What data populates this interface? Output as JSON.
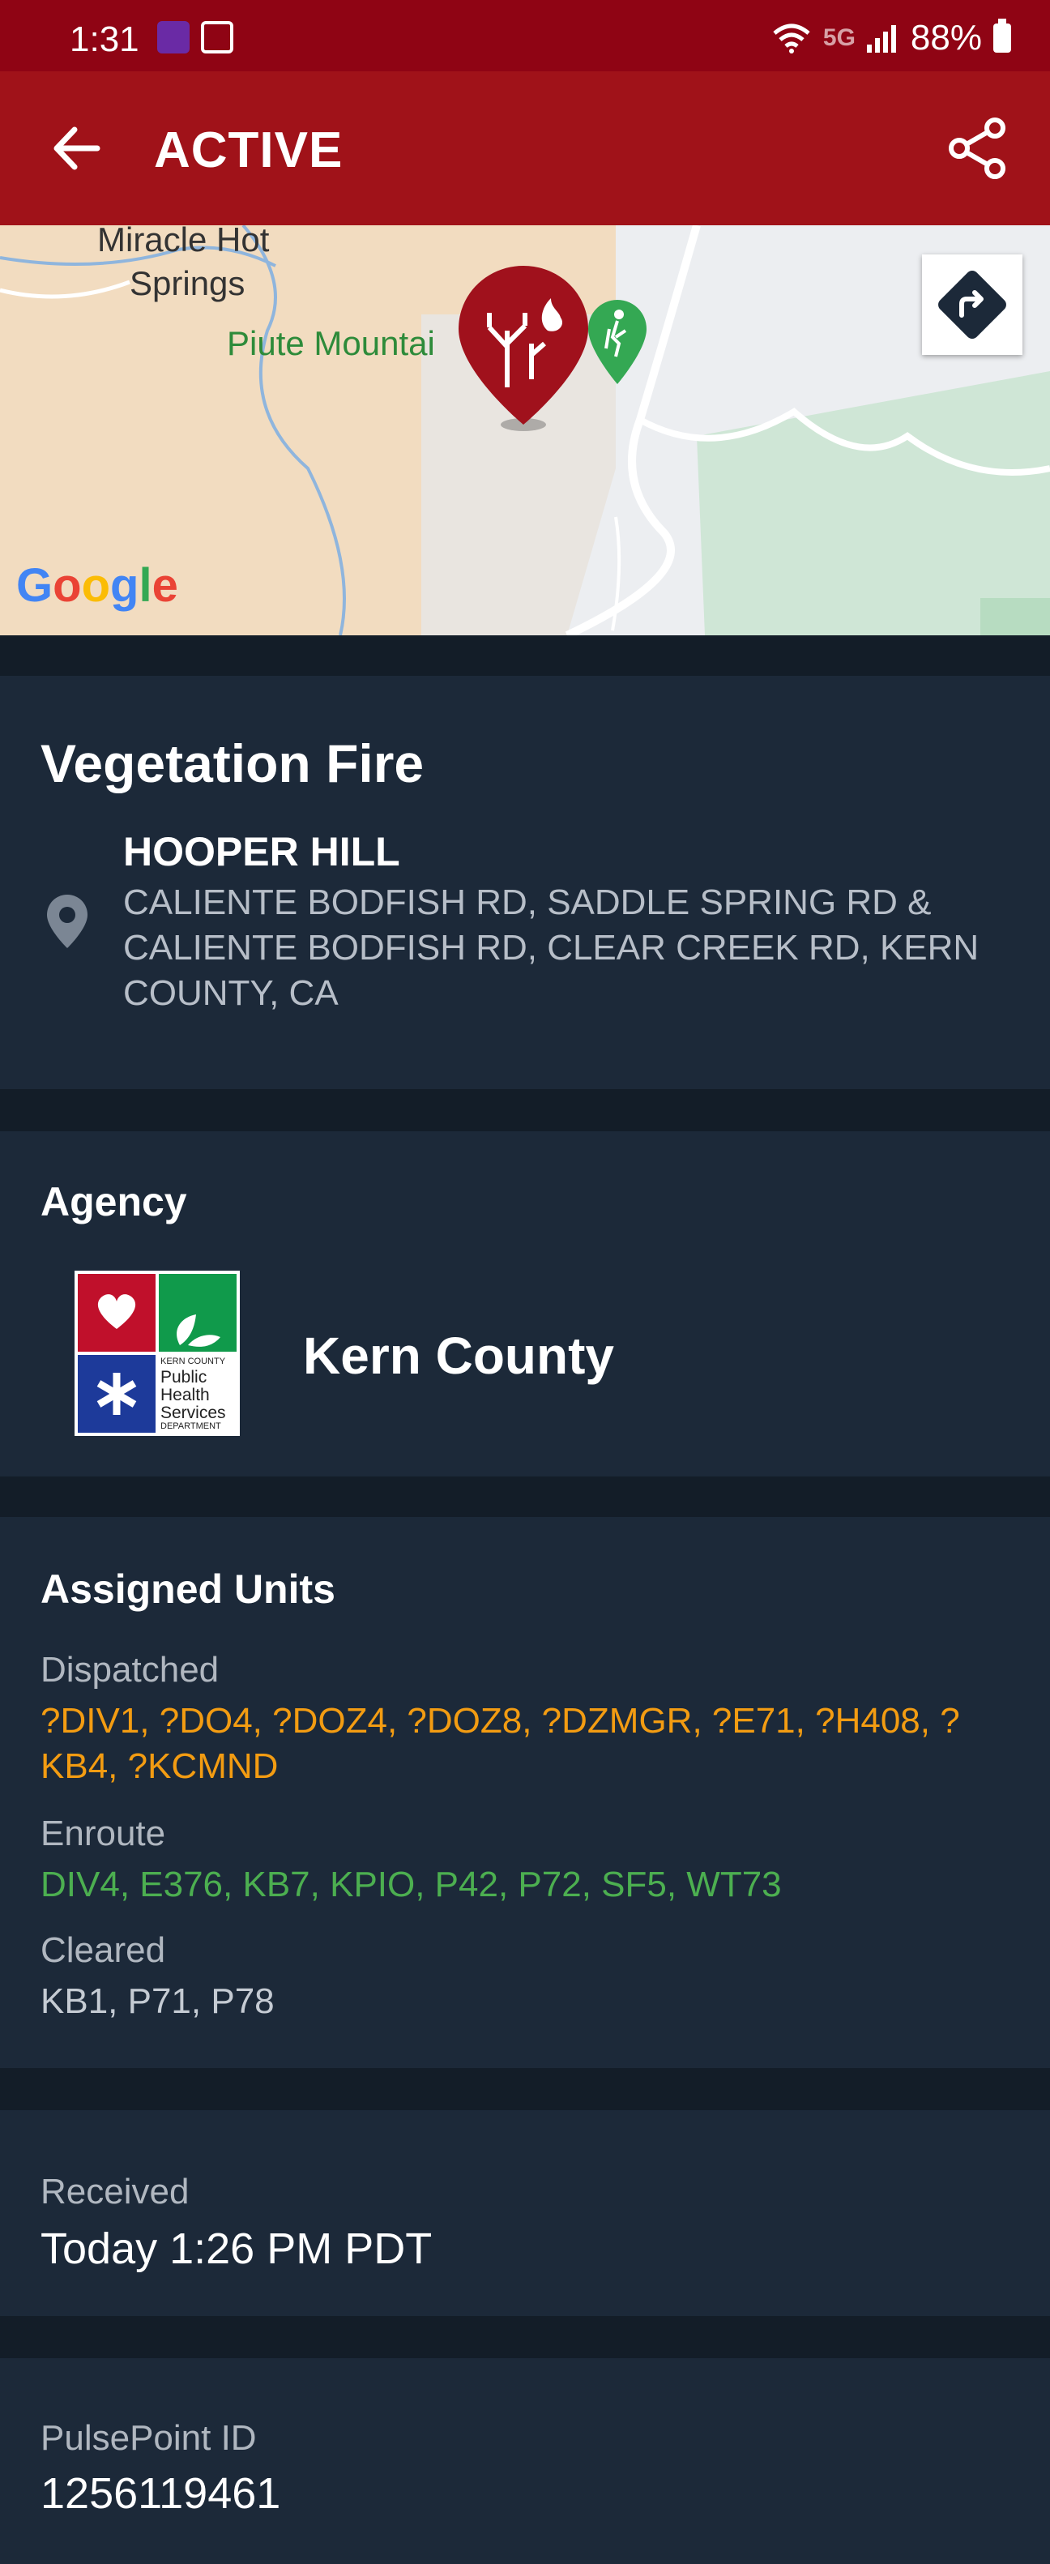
{
  "status_bar": {
    "time": "1:31",
    "network": "5G",
    "battery": "88%"
  },
  "app_bar": {
    "title": "ACTIVE"
  },
  "map": {
    "labels": [
      "Miracle Hot",
      "Springs",
      "Piute Mountai"
    ],
    "google": "Google"
  },
  "incident": {
    "type": "Vegetation Fire",
    "location_name": "HOOPER HILL",
    "address": "CALIENTE BODFISH RD, SADDLE SPRING RD  & CALIENTE BODFISH RD, CLEAR CREEK RD, KERN COUNTY, CA"
  },
  "agency": {
    "title": "Agency",
    "name": "Kern County",
    "logo_text": [
      "KERN COUNTY",
      "Public",
      "Health",
      "Services",
      "DEPARTMENT"
    ]
  },
  "units": {
    "title": "Assigned Units",
    "dispatched_label": "Dispatched",
    "dispatched": "?DIV1, ?DO4, ?DOZ4, ?DOZ8, ?DZMGR, ?E71, ?H408, ?KB4, ?KCMND",
    "enroute_label": "Enroute",
    "enroute": "DIV4, E376, KB7, KPIO, P42, P72, SF5, WT73",
    "cleared_label": "Cleared",
    "cleared": "KB1, P71, P78"
  },
  "received": {
    "label": "Received",
    "value": "Today 1:26 PM PDT"
  },
  "pulsepoint": {
    "label": "PulsePoint ID",
    "value": "1256119461"
  },
  "colors": {
    "status_bar": "#8f0414",
    "app_bar": "#a01219",
    "card": "#1c2939",
    "page_bg": "#131d28",
    "dispatched": "#f39c12",
    "enroute": "#4caf50"
  }
}
